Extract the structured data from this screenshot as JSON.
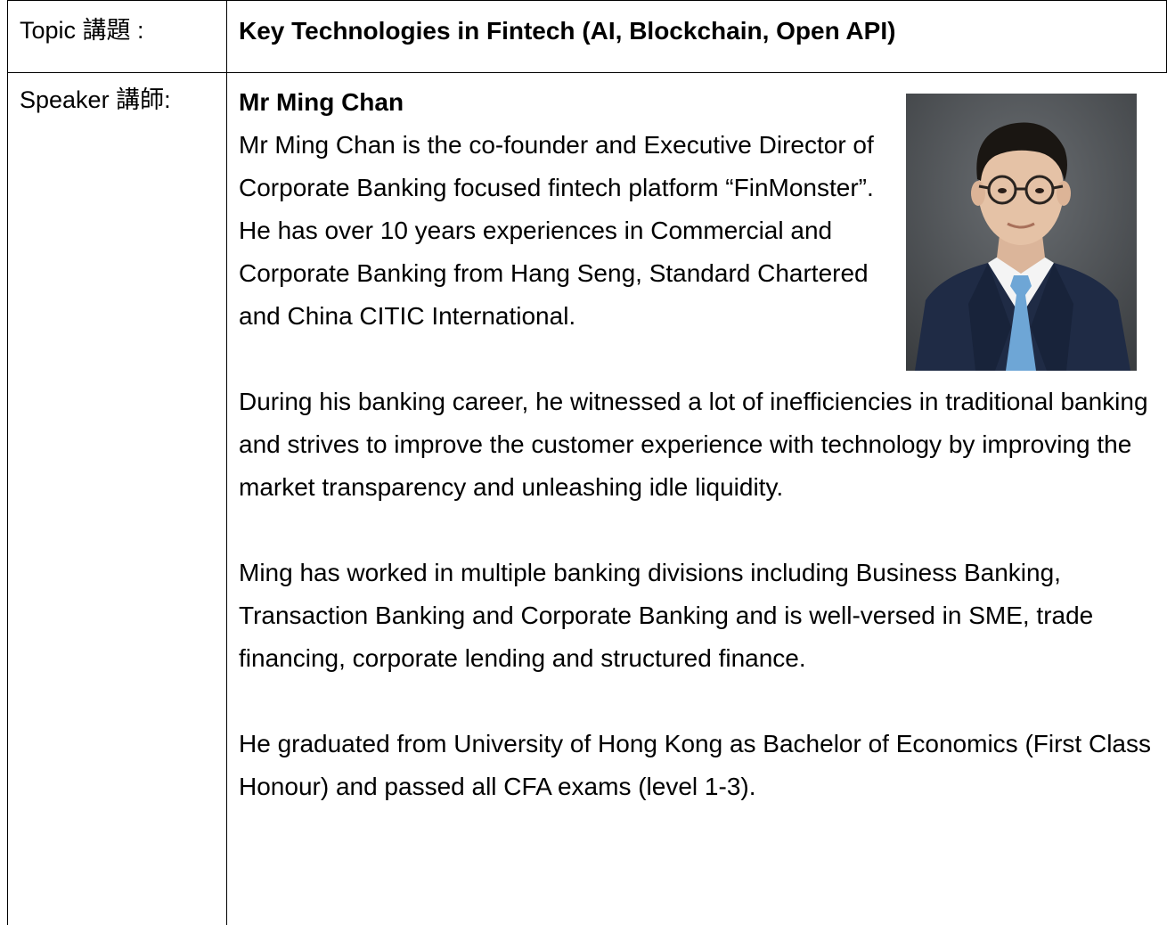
{
  "topic": {
    "label": "Topic 講題 :",
    "value": "Key Technologies in Fintech (AI, Blockchain, Open API)"
  },
  "speaker": {
    "label": "Speaker 講師:",
    "name": "Mr Ming Chan",
    "intro": "Mr Ming Chan is the co-founder and Executive Director of Corporate Banking focused fintech platform “FinMonster”. He has over 10 years experiences in Commercial and Corporate Banking from Hang Seng, Standard Chartered and China CITIC International.",
    "paragraphs": [
      "During his banking career, he witnessed a lot of inefficiencies in traditional banking and strives to improve the customer experience with technology by improving the market transparency and unleashing idle liquidity.",
      "Ming has worked in multiple banking divisions including Business Banking, Transaction Banking and Corporate Banking and is well-versed in SME, trade financing, corporate lending and structured finance.",
      "He graduated from University of Hong Kong as Bachelor of Economics (First Class Honour) and passed all CFA exams (level 1-3)."
    ],
    "photo_icon": "speaker-portrait"
  }
}
